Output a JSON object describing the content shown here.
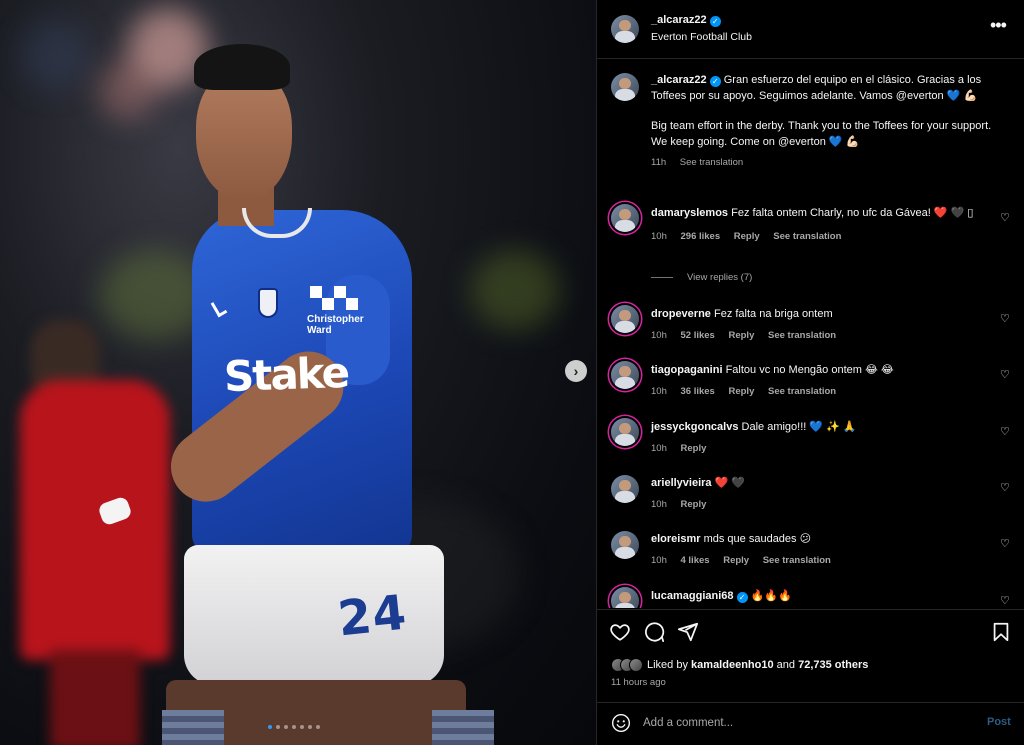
{
  "post": {
    "username": "_alcaraz22",
    "subtitle": "Everton Football Club",
    "more_icon": "more-horizontal-icon",
    "media": {
      "shirt_sponsor": "Stake",
      "sleeve_sponsor_line1": "Christopher",
      "sleeve_sponsor_line2": "Ward",
      "shorts_number": "24",
      "carousel_count": 7,
      "carousel_active_index": 0
    }
  },
  "caption": {
    "username": "_alcaraz22",
    "text_es": "Gran esfuerzo del equipo en el clásico. Gracias a los Toffees por su apoyo. Seguimos adelante. Vamos @everton 💙 💪🏻",
    "text_en": "Big team effort in the derby. Thank you to the Toffees for your support. We keep going. Come on @everton 💙 💪🏻",
    "time": "11h",
    "see_translation": "See translation"
  },
  "comments": [
    {
      "username": "damaryslemos",
      "text": "Fez falta ontem Charly, no ufc da Gávea! ❤️ 🖤 ▯",
      "time": "10h",
      "likes": "296 likes",
      "reply": "Reply",
      "see_translation": "See translation",
      "view_replies": "View replies (7)"
    },
    {
      "username": "dropeverne",
      "text": "Fez falta na briga ontem",
      "time": "10h",
      "likes": "52 likes",
      "reply": "Reply",
      "see_translation": "See translation"
    },
    {
      "username": "tiagopaganini",
      "text": "Faltou vc no Mengão ontem 😂 😂",
      "time": "10h",
      "likes": "36 likes",
      "reply": "Reply",
      "see_translation": "See translation"
    },
    {
      "username": "jessyckgoncalvs",
      "text": "Dale amigo!!! 💙 ✨ 🙏",
      "time": "10h",
      "reply": "Reply"
    },
    {
      "username": "ariellyvieira",
      "text": "❤️ 🖤",
      "time": "10h",
      "reply": "Reply"
    },
    {
      "username": "eloreismr",
      "text": "mds que saudades 😕",
      "time": "10h",
      "likes": "4 likes",
      "reply": "Reply",
      "see_translation": "See translation"
    },
    {
      "username": "lucamaggiani68",
      "text": "🔥🔥🔥"
    }
  ],
  "actions": {
    "liked_by_prefix": "Liked by",
    "liked_by_user": "kamaldeenho10",
    "and": "and",
    "others": "72,735 others",
    "time_ago": "11 hours ago"
  },
  "add_comment": {
    "placeholder": "Add a comment...",
    "post_label": "Post"
  },
  "colors": {
    "background": "#000000",
    "text": "#f5f5f5",
    "secondary": "#a8a8a8",
    "verified": "#0095f6",
    "post_disabled": "#2b5c86",
    "everton_blue": "#1c47b4"
  }
}
